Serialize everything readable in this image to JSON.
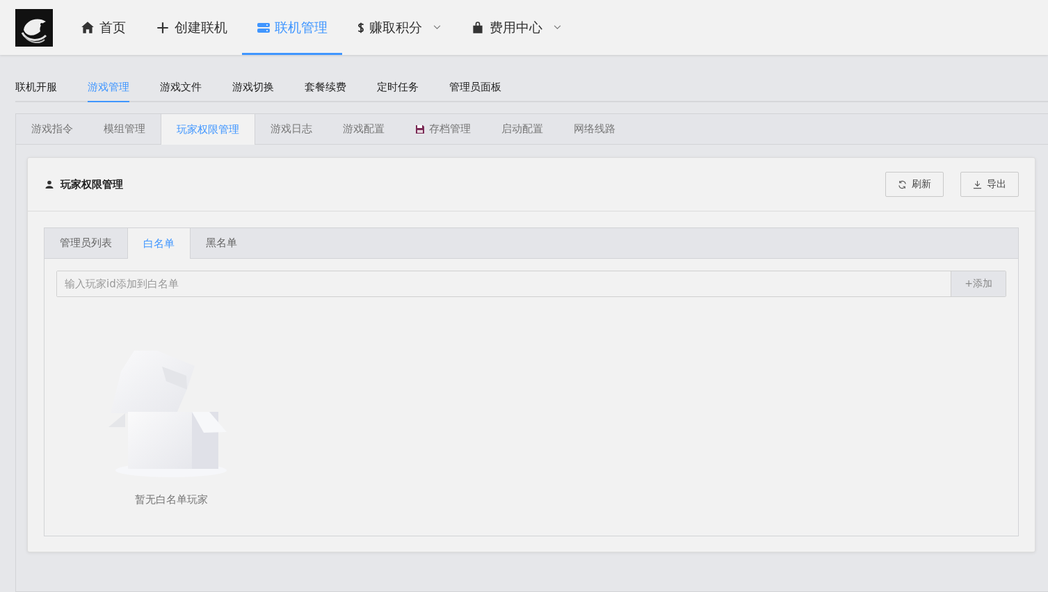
{
  "top_nav": [
    {
      "label": "首页",
      "dropdown": false,
      "selected": false
    },
    {
      "label": "创建联机",
      "dropdown": false,
      "selected": false
    },
    {
      "label": "联机管理",
      "dropdown": false,
      "selected": true
    },
    {
      "label": "赚取积分",
      "dropdown": true,
      "selected": false
    },
    {
      "label": "费用中心",
      "dropdown": true,
      "selected": false
    }
  ],
  "sub_nav": [
    {
      "label": "联机开服",
      "selected": false
    },
    {
      "label": "游戏管理",
      "selected": true
    },
    {
      "label": "游戏文件",
      "selected": false
    },
    {
      "label": "游戏切换",
      "selected": false
    },
    {
      "label": "套餐续费",
      "selected": false
    },
    {
      "label": "定时任务",
      "selected": false
    },
    {
      "label": "管理员面板",
      "selected": false
    }
  ],
  "tabs": [
    {
      "label": "游戏指令",
      "selected": false
    },
    {
      "label": "模组管理",
      "selected": false
    },
    {
      "label": "玩家权限管理",
      "selected": true
    },
    {
      "label": "游戏日志",
      "selected": false
    },
    {
      "label": "游戏配置",
      "selected": false
    },
    {
      "label": "存档管理",
      "selected": false
    },
    {
      "label": "启动配置",
      "selected": false
    },
    {
      "label": "网络线路",
      "selected": false
    }
  ],
  "card": {
    "title": "玩家权限管理",
    "buttons": [
      {
        "label": "刷新"
      },
      {
        "label": "导出"
      }
    ],
    "inner_tabs": [
      {
        "label": "管理员列表",
        "selected": false
      },
      {
        "label": "白名单",
        "selected": true
      },
      {
        "label": "黑名单",
        "selected": false
      }
    ],
    "input": {
      "placeholder": "输入玩家id添加到白名单",
      "button": "+添加"
    },
    "empty_text": "暂无白名单玩家"
  }
}
